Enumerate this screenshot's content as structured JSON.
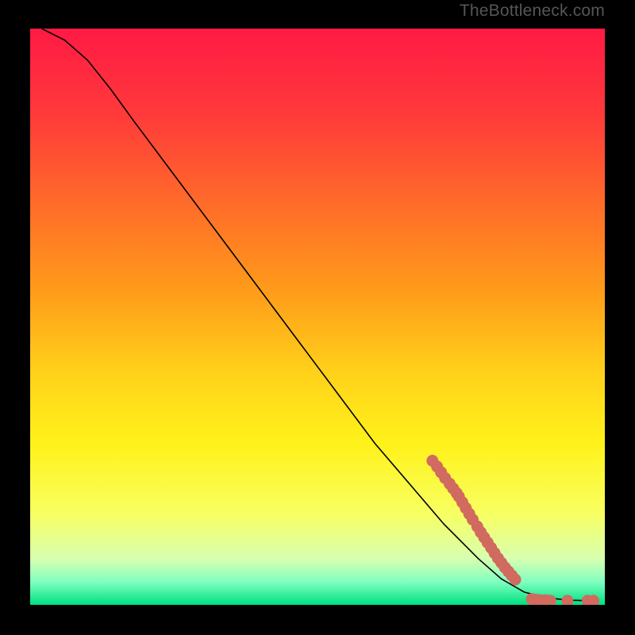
{
  "attribution": "TheBottleneck.com",
  "chart_data": {
    "type": "line",
    "title": "",
    "xlabel": "",
    "ylabel": "",
    "xlim": [
      0,
      100
    ],
    "ylim": [
      0,
      100
    ],
    "background_gradient": {
      "stops": [
        {
          "pos": 0.0,
          "color": "#ff1a44"
        },
        {
          "pos": 0.15,
          "color": "#ff3a3a"
        },
        {
          "pos": 0.3,
          "color": "#ff6a2a"
        },
        {
          "pos": 0.45,
          "color": "#ff9a1a"
        },
        {
          "pos": 0.6,
          "color": "#ffd21a"
        },
        {
          "pos": 0.72,
          "color": "#fff21a"
        },
        {
          "pos": 0.84,
          "color": "#f8ff60"
        },
        {
          "pos": 0.92,
          "color": "#d8ffb0"
        },
        {
          "pos": 0.96,
          "color": "#80ffc0"
        },
        {
          "pos": 1.0,
          "color": "#00e080"
        }
      ]
    },
    "series": [
      {
        "name": "curve",
        "type": "line",
        "color": "#000000",
        "points": [
          {
            "x": 2.0,
            "y": 100.0
          },
          {
            "x": 6.0,
            "y": 98.0
          },
          {
            "x": 10.0,
            "y": 94.5
          },
          {
            "x": 14.0,
            "y": 89.5
          },
          {
            "x": 18.0,
            "y": 84.0
          },
          {
            "x": 24.0,
            "y": 76.0
          },
          {
            "x": 30.0,
            "y": 68.0
          },
          {
            "x": 36.0,
            "y": 60.0
          },
          {
            "x": 42.0,
            "y": 52.0
          },
          {
            "x": 48.0,
            "y": 44.0
          },
          {
            "x": 54.0,
            "y": 36.0
          },
          {
            "x": 60.0,
            "y": 28.0
          },
          {
            "x": 66.0,
            "y": 21.0
          },
          {
            "x": 72.0,
            "y": 14.0
          },
          {
            "x": 78.0,
            "y": 8.0
          },
          {
            "x": 82.0,
            "y": 4.5
          },
          {
            "x": 86.0,
            "y": 2.2
          },
          {
            "x": 90.0,
            "y": 1.2
          },
          {
            "x": 94.0,
            "y": 0.8
          },
          {
            "x": 98.0,
            "y": 0.7
          }
        ]
      },
      {
        "name": "markers",
        "type": "scatter",
        "color": "#d16a5f",
        "points": [
          {
            "x": 70.0,
            "y": 25.0
          },
          {
            "x": 70.8,
            "y": 24.0
          },
          {
            "x": 71.5,
            "y": 23.0
          },
          {
            "x": 72.2,
            "y": 22.0
          },
          {
            "x": 73.0,
            "y": 21.0
          },
          {
            "x": 73.6,
            "y": 20.2
          },
          {
            "x": 74.2,
            "y": 19.4
          },
          {
            "x": 74.6,
            "y": 18.8
          },
          {
            "x": 75.2,
            "y": 17.8
          },
          {
            "x": 75.8,
            "y": 16.8
          },
          {
            "x": 76.4,
            "y": 15.8
          },
          {
            "x": 77.0,
            "y": 14.8
          },
          {
            "x": 77.8,
            "y": 13.6
          },
          {
            "x": 78.4,
            "y": 12.6
          },
          {
            "x": 79.0,
            "y": 11.7
          },
          {
            "x": 79.6,
            "y": 10.8
          },
          {
            "x": 80.2,
            "y": 9.9
          },
          {
            "x": 80.8,
            "y": 9.0
          },
          {
            "x": 81.4,
            "y": 8.1
          },
          {
            "x": 82.0,
            "y": 7.3
          },
          {
            "x": 82.6,
            "y": 6.5
          },
          {
            "x": 83.2,
            "y": 5.8
          },
          {
            "x": 83.8,
            "y": 5.1
          },
          {
            "x": 84.4,
            "y": 4.4
          },
          {
            "x": 87.3,
            "y": 1.0
          },
          {
            "x": 88.0,
            "y": 0.9
          },
          {
            "x": 88.8,
            "y": 0.8
          },
          {
            "x": 89.7,
            "y": 0.8
          },
          {
            "x": 90.5,
            "y": 0.7
          },
          {
            "x": 93.5,
            "y": 0.7
          },
          {
            "x": 97.0,
            "y": 0.7
          },
          {
            "x": 98.0,
            "y": 0.7
          }
        ]
      }
    ]
  }
}
